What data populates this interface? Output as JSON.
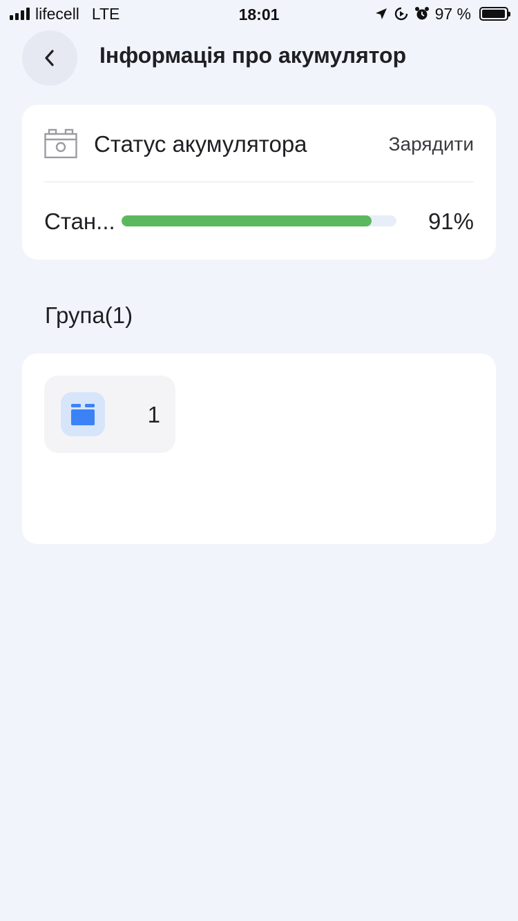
{
  "status_bar": {
    "carrier": "lifecell",
    "network": "LTE",
    "time": "18:01",
    "battery_text": "97 %",
    "battery_level": 0.97,
    "icons": [
      "signal-icon",
      "location-arrow-icon",
      "screen-rotation-lock-icon",
      "alarm-icon",
      "battery-icon"
    ]
  },
  "header": {
    "back_icon": "chevron-left-icon",
    "title": "Інформація про акумулятор"
  },
  "battery_status": {
    "icon": "battery-icon",
    "label": "Статус акумулятора",
    "action": "Зарядити",
    "state_label": "Стан...",
    "level_text": "91%",
    "level": 0.91,
    "bar_color": "#5cb85c"
  },
  "group": {
    "heading": "Група(1)",
    "items": [
      {
        "icon": "device-group-icon",
        "label": "1"
      }
    ]
  },
  "colors": {
    "background": "#f1f4fb",
    "card": "#ffffff",
    "accent_blue": "#3b82f6"
  }
}
